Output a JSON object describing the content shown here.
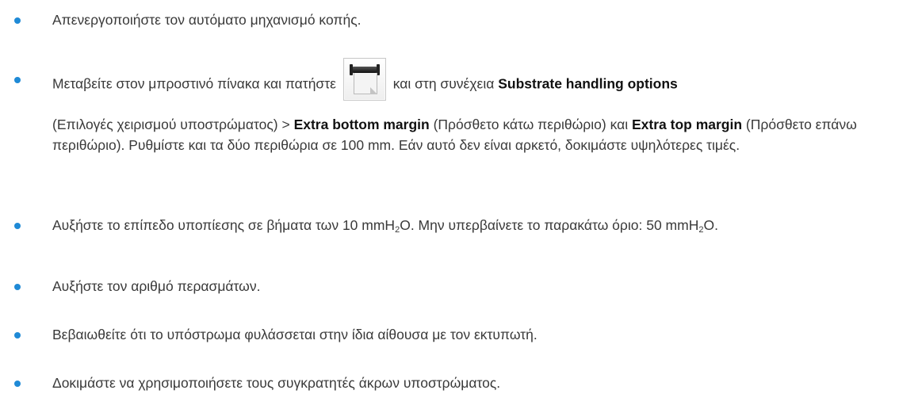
{
  "items": [
    {
      "text": "Απενεργοποιήστε τον αυτόματο μηχανισμό κοπής."
    },
    {
      "pre": "Μεταβείτε στον μπροστινό πίνακα και πατήστε",
      "icon": "substrate-roll-icon",
      "mid": "και στη συνέχεια",
      "b1": "Substrate handling options",
      "c1": "(Επιλογές χειρισμού υποστρώματος) >",
      "b2": "Extra bottom margin",
      "c2": "(Πρόσθετο κάτω περιθώριο) και",
      "b3": "Extra top margin",
      "c3": "(Πρόσθετο επάνω περιθώριο). Ρυθμίστε και τα δύο περιθώρια σε 100 mm. Εάν αυτό δεν είναι αρκετό, δοκιμάστε υψηλότερες τιμές."
    },
    {
      "t1": "Αυξήστε το επίπεδο υποπίεσης σε βήματα των 10 mmH",
      "s1": "2",
      "t2": "O. Μην υπερβαίνετε το παρακάτω όριο: 50 mmH",
      "s2": "2",
      "t3": "O."
    },
    {
      "text": "Αυξήστε τον αριθμό περασμάτων."
    },
    {
      "text": "Βεβαιωθείτε ότι το υπόστρωμα φυλάσσεται στην ίδια αίθουσα με τον εκτυπωτή."
    },
    {
      "text": "Δοκιμάστε να χρησιμοποιήσετε τους συγκρατητές άκρων υποστρώματος."
    }
  ],
  "colors": {
    "bullet": "#1f8ad6",
    "text": "#3a3a3a",
    "bold": "#111111"
  }
}
